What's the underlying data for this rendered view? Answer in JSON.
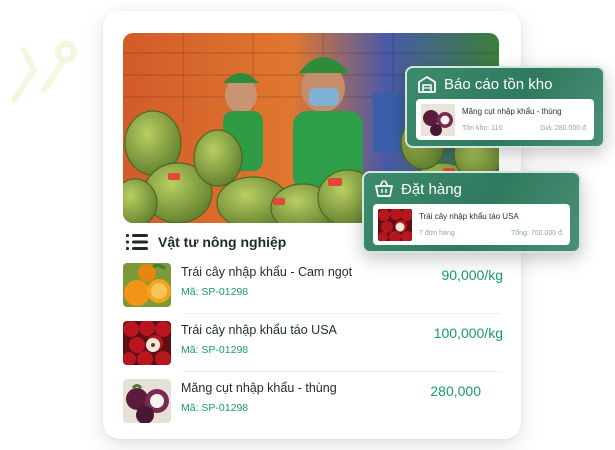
{
  "main_card": {
    "section_title": "Vật tư nông nghiệp",
    "products": [
      {
        "name": "Trái cây nhập khẩu - Cam ngọt",
        "code": "Mã: SP-01298",
        "price": "90,000/kg"
      },
      {
        "name": "Trái cây nhập khẩu táo USA",
        "code": "Mã: SP-01298",
        "price": "100,000/kg"
      },
      {
        "name": "Măng cụt nhập khẩu - thùng",
        "code": "Mã: SP-01298",
        "price": "280,000"
      }
    ]
  },
  "inventory_card": {
    "title": "Báo cáo tồn kho",
    "item_name": "Măng cụt nhập khẩu - thùng",
    "stock": "Tồn kho: 110",
    "price": "Giá: 280.000 đ"
  },
  "order_card": {
    "title": "Đặt hàng",
    "item_name": "Trái cây nhập khẩu táo USA",
    "orders": "7 đơn hàng",
    "total": "Tổng: 700.000 đ"
  },
  "colors": {
    "accent_green": "#1a9a6c",
    "card_green": "#2f7a5e",
    "text_dark": "#1f2a2e"
  },
  "icons": {
    "list": "list-icon",
    "warehouse": "warehouse-icon",
    "basket": "basket-icon"
  }
}
